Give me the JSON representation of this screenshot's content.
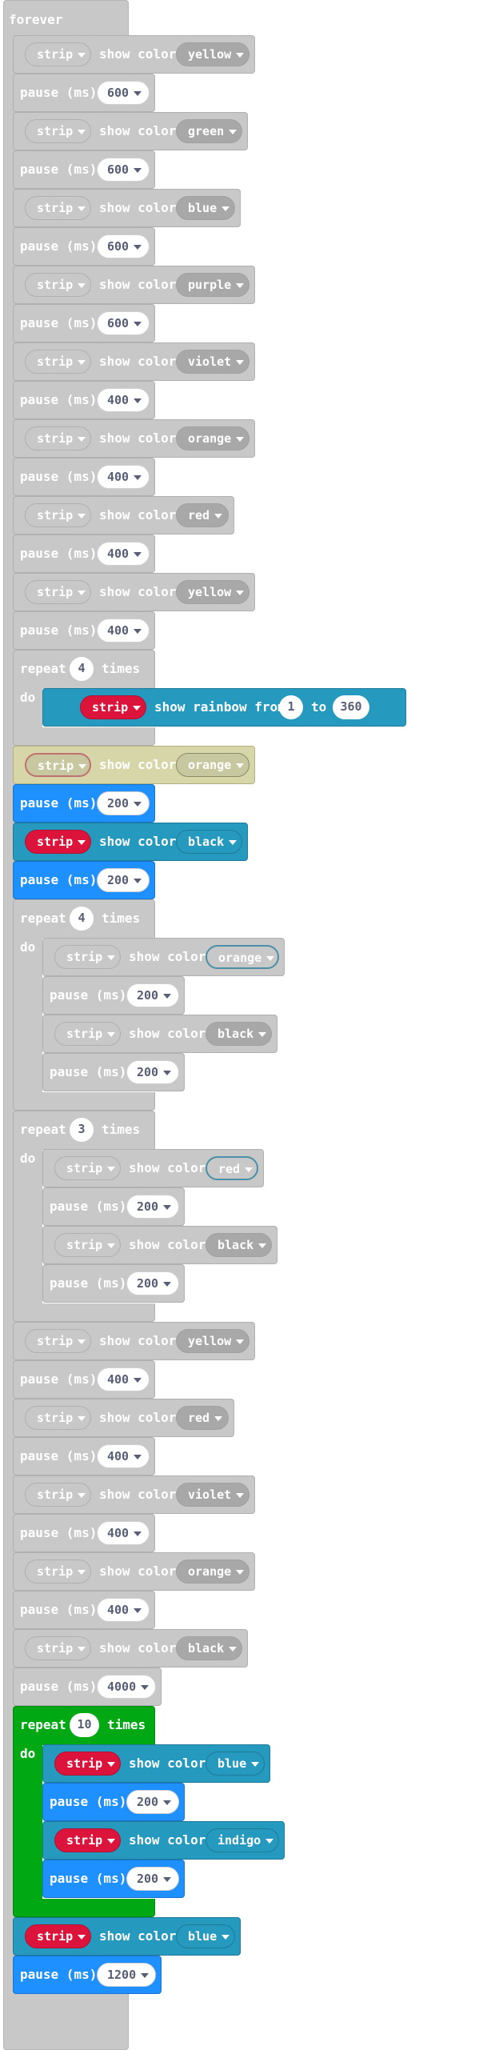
{
  "event": {
    "label": "forever"
  },
  "labels": {
    "show_color": "show color",
    "pause": "pause (ms)",
    "strip": "strip",
    "repeat": "repeat",
    "times": "times",
    "do": "do",
    "show_rainbow_from": "show rainbow from",
    "to": "to"
  },
  "program": [
    {
      "type": "show_color",
      "color": "yellow",
      "style": "disabled"
    },
    {
      "type": "pause",
      "ms": "600",
      "style": "disabled"
    },
    {
      "type": "show_color",
      "color": "green",
      "style": "disabled"
    },
    {
      "type": "pause",
      "ms": "600",
      "style": "disabled"
    },
    {
      "type": "show_color",
      "color": "blue",
      "style": "disabled"
    },
    {
      "type": "pause",
      "ms": "600",
      "style": "disabled"
    },
    {
      "type": "show_color",
      "color": "purple",
      "style": "disabled"
    },
    {
      "type": "pause",
      "ms": "600",
      "style": "disabled"
    },
    {
      "type": "show_color",
      "color": "violet",
      "style": "disabled"
    },
    {
      "type": "pause",
      "ms": "400",
      "style": "disabled"
    },
    {
      "type": "show_color",
      "color": "orange",
      "style": "disabled"
    },
    {
      "type": "pause",
      "ms": "400",
      "style": "disabled"
    },
    {
      "type": "show_color",
      "color": "red",
      "style": "disabled"
    },
    {
      "type": "pause",
      "ms": "400",
      "style": "disabled"
    },
    {
      "type": "show_color",
      "color": "yellow",
      "style": "disabled"
    },
    {
      "type": "pause",
      "ms": "400",
      "style": "disabled"
    },
    {
      "type": "repeat",
      "times": "4",
      "style": "disabled",
      "body": [
        {
          "type": "rainbow",
          "from": "1",
          "to": "360",
          "style": "active"
        }
      ]
    },
    {
      "type": "show_color",
      "color": "orange",
      "style": "highlighted"
    },
    {
      "type": "pause",
      "ms": "200",
      "style": "active"
    },
    {
      "type": "show_color",
      "color": "black",
      "style": "active"
    },
    {
      "type": "pause",
      "ms": "200",
      "style": "active"
    },
    {
      "type": "repeat",
      "times": "4",
      "style": "disabled",
      "body": [
        {
          "type": "show_color",
          "color": "orange",
          "style": "disabled"
        },
        {
          "type": "pause",
          "ms": "200",
          "style": "disabled"
        },
        {
          "type": "show_color",
          "color": "black",
          "style": "disabled"
        },
        {
          "type": "pause",
          "ms": "200",
          "style": "disabled"
        }
      ]
    },
    {
      "type": "repeat",
      "times": "3",
      "style": "disabled",
      "body": [
        {
          "type": "show_color",
          "color": "red",
          "style": "disabled"
        },
        {
          "type": "pause",
          "ms": "200",
          "style": "disabled"
        },
        {
          "type": "show_color",
          "color": "black",
          "style": "disabled"
        },
        {
          "type": "pause",
          "ms": "200",
          "style": "disabled"
        }
      ]
    },
    {
      "type": "show_color",
      "color": "yellow",
      "style": "disabled"
    },
    {
      "type": "pause",
      "ms": "400",
      "style": "disabled"
    },
    {
      "type": "show_color",
      "color": "red",
      "style": "disabled"
    },
    {
      "type": "pause",
      "ms": "400",
      "style": "disabled"
    },
    {
      "type": "show_color",
      "color": "violet",
      "style": "disabled"
    },
    {
      "type": "pause",
      "ms": "400",
      "style": "disabled"
    },
    {
      "type": "show_color",
      "color": "orange",
      "style": "disabled"
    },
    {
      "type": "pause",
      "ms": "400",
      "style": "disabled"
    },
    {
      "type": "show_color",
      "color": "black",
      "style": "disabled"
    },
    {
      "type": "pause",
      "ms": "4000",
      "style": "disabled"
    },
    {
      "type": "repeat",
      "times": "10",
      "style": "loop",
      "body": [
        {
          "type": "show_color",
          "color": "blue",
          "style": "active"
        },
        {
          "type": "pause",
          "ms": "200",
          "style": "active"
        },
        {
          "type": "show_color",
          "color": "indigo",
          "style": "active"
        },
        {
          "type": "pause",
          "ms": "200",
          "style": "active"
        }
      ]
    },
    {
      "type": "show_color",
      "color": "blue",
      "style": "active"
    },
    {
      "type": "pause",
      "ms": "1200",
      "style": "active"
    }
  ],
  "colors": {
    "disabled_block": "#c8c8c8",
    "neopixel_block": "#2699bf",
    "pause_block": "#1e90ff",
    "loop_block": "#00a914",
    "strip_variable": "#dc143c",
    "highlight_block": "#d6d6a8"
  }
}
